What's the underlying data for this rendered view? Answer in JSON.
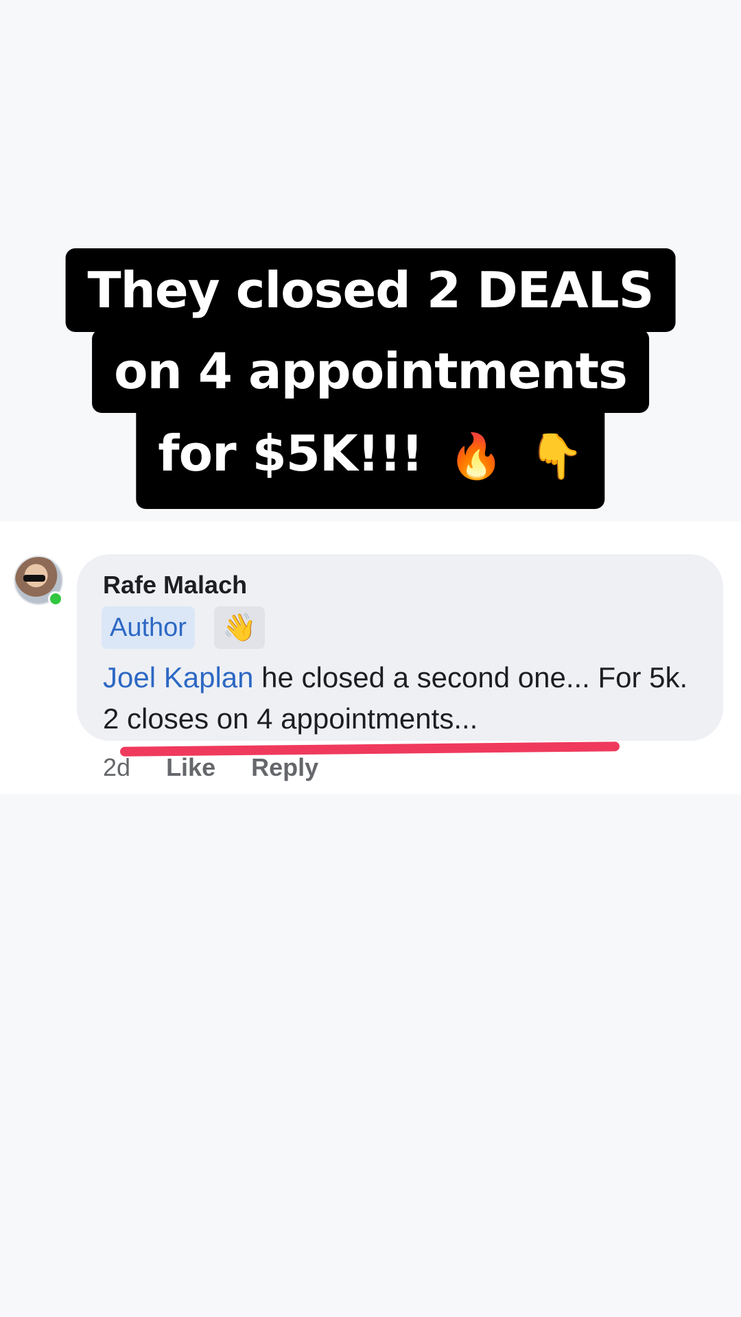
{
  "caption": {
    "line1": "They closed 2 DEALS",
    "line2": "on 4 appointments",
    "line3": "for $5K!!!",
    "emoji1": "🔥",
    "emoji2": "👇"
  },
  "comment": {
    "author": "Rafe Malach",
    "badge": "Author",
    "badge_icon": "👋",
    "mention": "Joel Kaplan",
    "text": " he closed a second one... For 5k. 2 closes on 4 appointments...",
    "time": "2d",
    "like": "Like",
    "reply": "Reply"
  },
  "colors": {
    "mention": "#2d68c4",
    "highlight_underline": "#ef3a5d",
    "online": "#31c740"
  }
}
